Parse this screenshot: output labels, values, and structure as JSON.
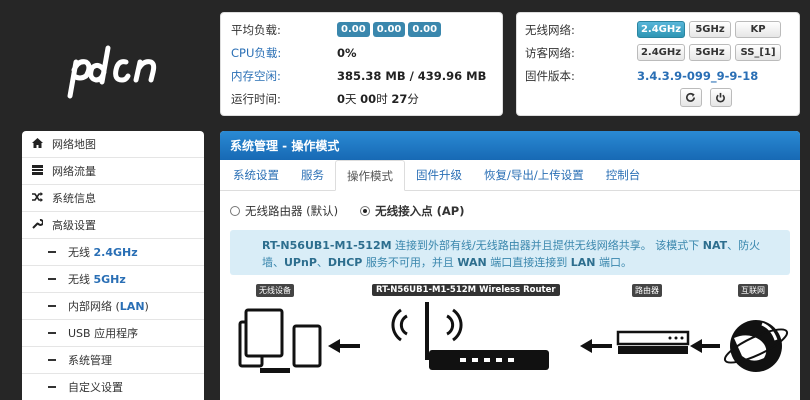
{
  "logo_text": "pdcn",
  "status": {
    "load_label": "平均负载:",
    "load_values": [
      "0.00",
      "0.00",
      "0.00"
    ],
    "cpu_label": "CPU负载:",
    "cpu_value": "0%",
    "mem_label": "内存空闲:",
    "mem_value": "385.38 MB / 439.96 MB",
    "uptime_label": "运行时间:",
    "uptime_d": "0",
    "uptime_d_unit": "天 ",
    "uptime_h": "00",
    "uptime_h_unit": "时 ",
    "uptime_m": "27",
    "uptime_m_unit": "分"
  },
  "wifi": {
    "wireless_label": "无线网络:",
    "wireless_buttons": [
      "2.4GHz",
      "5GHz",
      "KP"
    ],
    "guest_label": "访客网络:",
    "guest_buttons": [
      "2.4GHz",
      "5GHz",
      "SS_[1]"
    ],
    "fw_label": "固件版本:",
    "fw_value": "3.4.3.9-099_9-9-18"
  },
  "sidebar": {
    "items": [
      {
        "label": "网络地图",
        "icon": "home-icon"
      },
      {
        "label": "网络流量",
        "icon": "traffic-icon"
      },
      {
        "label": "系统信息",
        "icon": "shuffle-icon"
      },
      {
        "label": "高级设置",
        "icon": "wrench-icon"
      }
    ],
    "subitems": [
      {
        "prefix": "无线 ",
        "hl": "2.4GHz",
        "suffix": ""
      },
      {
        "prefix": "无线 ",
        "hl": "5GHz",
        "suffix": ""
      },
      {
        "prefix": "内部网络 (",
        "hl": "LAN",
        "suffix": ")"
      },
      {
        "prefix": "USB 应用程序",
        "hl": "",
        "suffix": ""
      },
      {
        "prefix": "系统管理",
        "hl": "",
        "suffix": ""
      },
      {
        "prefix": "自定义设置",
        "hl": "",
        "suffix": ""
      }
    ]
  },
  "main": {
    "header": "系统管理 - 操作模式",
    "tabs": [
      "系统设置",
      "服务",
      "操作模式",
      "固件升级",
      "恢复/导出/上传设置",
      "控制台"
    ],
    "active_tab": 2,
    "radio_router": "无线路由器 (默认)",
    "radio_ap": "无线接入点 (AP)",
    "info_model": "RT-N56UB1-M1-512M",
    "info_text1": " 连接到外部有线/无线路由器并且提供无线网络共享。 该模式下 ",
    "info_nat": "NAT",
    "info_text2": "、防火墙、",
    "info_upnp": "UPnP",
    "info_text3": "、",
    "info_dhcp": "DHCP",
    "info_text4": " 服务不可用，并且 ",
    "info_wan": "WAN",
    "info_text5": " 端口直接连接到 ",
    "info_lan": "LAN",
    "info_text6": " 端口。",
    "diagram": {
      "label_wireless": "无线设备",
      "label_device": "RT-N56UB1-M1-512M Wireless Router",
      "label_router": "路由器",
      "label_internet": "互联网"
    }
  }
}
